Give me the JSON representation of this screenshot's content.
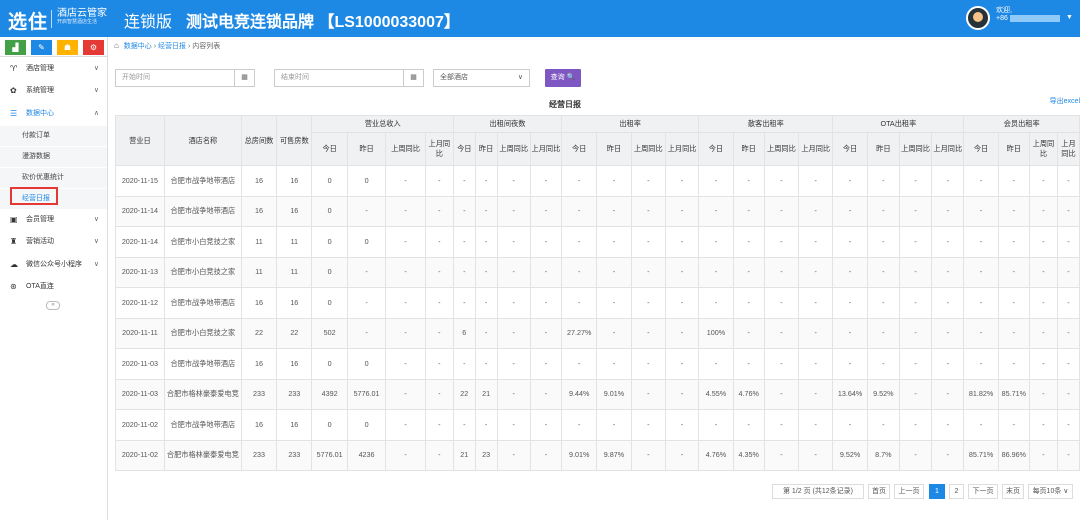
{
  "header": {
    "logo_main": "选住",
    "logo_sub": "酒店云管家",
    "logo_tagline": "开启智慧酒店生活",
    "edition": "连锁版",
    "brand": "测试电竞连锁品牌 【LS1000033007】",
    "welcome": "欢迎,",
    "phone_prefix": "+86"
  },
  "sidebar": {
    "toolbar": [
      "▟",
      "✎",
      "☗",
      "⚙"
    ],
    "items": [
      {
        "label": "酒店管理",
        "icon": "♈"
      },
      {
        "label": "系统管理",
        "icon": "✿"
      },
      {
        "label": "数据中心",
        "icon": "☰"
      },
      {
        "label": "会员管理",
        "icon": "▣"
      },
      {
        "label": "营销活动",
        "icon": "♜"
      },
      {
        "label": "微信公众号小程序",
        "icon": "☁"
      },
      {
        "label": "OTA直连",
        "icon": "⊛"
      }
    ],
    "subitems": [
      "付款订单",
      "漫游数据",
      "砍价优惠统计",
      "经营日报"
    ],
    "collapse": "«"
  },
  "breadcrumb": {
    "home": "数据中心",
    "report": "经营日报",
    "list": "内容列表",
    "sep": "›"
  },
  "filters": {
    "start_placeholder": "开始时间",
    "end_placeholder": "结束时间",
    "hotel_select": "全部酒店",
    "query": "查询 🔍"
  },
  "report": {
    "title": "经营日报",
    "export": "导出excel"
  },
  "table": {
    "group_headers": [
      "营业日",
      "酒店名称",
      "总房间数",
      "可售房数",
      "营业总收入",
      "出租间夜数",
      "出租率",
      "散客出租率",
      "OTA出租率",
      "会员出租率"
    ],
    "sub_headers": [
      "今日",
      "昨日",
      "上周同比",
      "上月同比"
    ],
    "rows": [
      [
        "2020-11-15",
        "合肥市战争地带酒店",
        "16",
        "16",
        "0",
        "0",
        "-",
        "-",
        "-",
        "-",
        "-",
        "-",
        "-",
        "-",
        "-",
        "-",
        "-",
        "-",
        "-",
        "-",
        "-",
        "-",
        "-",
        "-",
        "-",
        "-",
        "-",
        "-"
      ],
      [
        "2020-11-14",
        "合肥市战争地带酒店",
        "16",
        "16",
        "0",
        "-",
        "-",
        "-",
        "-",
        "-",
        "-",
        "-",
        "-",
        "-",
        "-",
        "-",
        "-",
        "-",
        "-",
        "-",
        "-",
        "-",
        "-",
        "-",
        "-",
        "-",
        "-",
        "-"
      ],
      [
        "2020-11-14",
        "合肥市小白竞技之家",
        "11",
        "11",
        "0",
        "0",
        "-",
        "-",
        "-",
        "-",
        "-",
        "-",
        "-",
        "-",
        "-",
        "-",
        "-",
        "-",
        "-",
        "-",
        "-",
        "-",
        "-",
        "-",
        "-",
        "-",
        "-",
        "-"
      ],
      [
        "2020-11-13",
        "合肥市小白竞技之家",
        "11",
        "11",
        "0",
        "-",
        "-",
        "-",
        "-",
        "-",
        "-",
        "-",
        "-",
        "-",
        "-",
        "-",
        "-",
        "-",
        "-",
        "-",
        "-",
        "-",
        "-",
        "-",
        "-",
        "-",
        "-",
        "-"
      ],
      [
        "2020-11-12",
        "合肥市战争地带酒店",
        "16",
        "16",
        "0",
        "-",
        "-",
        "-",
        "-",
        "-",
        "-",
        "-",
        "-",
        "-",
        "-",
        "-",
        "-",
        "-",
        "-",
        "-",
        "-",
        "-",
        "-",
        "-",
        "-",
        "-",
        "-",
        "-"
      ],
      [
        "2020-11-11",
        "合肥市小白竞技之家",
        "22",
        "22",
        "502",
        "-",
        "-",
        "-",
        "6",
        "-",
        "-",
        "-",
        "27.27%",
        "-",
        "-",
        "-",
        "100%",
        "-",
        "-",
        "-",
        "-",
        "-",
        "-",
        "-",
        "-",
        "-",
        "-",
        "-"
      ],
      [
        "2020-11-03",
        "合肥市战争地带酒店",
        "16",
        "16",
        "0",
        "0",
        "-",
        "-",
        "-",
        "-",
        "-",
        "-",
        "-",
        "-",
        "-",
        "-",
        "-",
        "-",
        "-",
        "-",
        "-",
        "-",
        "-",
        "-",
        "-",
        "-",
        "-",
        "-"
      ],
      [
        "2020-11-03",
        "合肥市格林豪泰爱电竞",
        "233",
        "233",
        "4392",
        "5776.01",
        "-",
        "-",
        "22",
        "21",
        "-",
        "-",
        "9.44%",
        "9.01%",
        "-",
        "-",
        "4.55%",
        "4.76%",
        "-",
        "-",
        "13.64%",
        "9.52%",
        "-",
        "-",
        "81.82%",
        "85.71%",
        "-",
        "-"
      ],
      [
        "2020-11-02",
        "合肥市战争地带酒店",
        "16",
        "16",
        "0",
        "0",
        "-",
        "-",
        "-",
        "-",
        "-",
        "-",
        "-",
        "-",
        "-",
        "-",
        "-",
        "-",
        "-",
        "-",
        "-",
        "-",
        "-",
        "-",
        "-",
        "-",
        "-",
        "-"
      ],
      [
        "2020-11-02",
        "合肥市格林豪泰爱电竞",
        "233",
        "233",
        "5776.01",
        "4236",
        "-",
        "-",
        "21",
        "23",
        "-",
        "-",
        "9.01%",
        "9.87%",
        "-",
        "-",
        "4.76%",
        "4.35%",
        "-",
        "-",
        "9.52%",
        "8.7%",
        "-",
        "-",
        "85.71%",
        "86.96%",
        "-",
        "-"
      ]
    ]
  },
  "pagination": {
    "info": "第 1/2 页 (共12条记录)",
    "first": "首页",
    "prev": "上一页",
    "p1": "1",
    "p2": "2",
    "next": "下一页",
    "last": "末页",
    "per_page": "每页10条 ∨"
  },
  "colors": {
    "header": "#1e88e5",
    "query": "#7e57c2",
    "highlight": "#e53935"
  }
}
